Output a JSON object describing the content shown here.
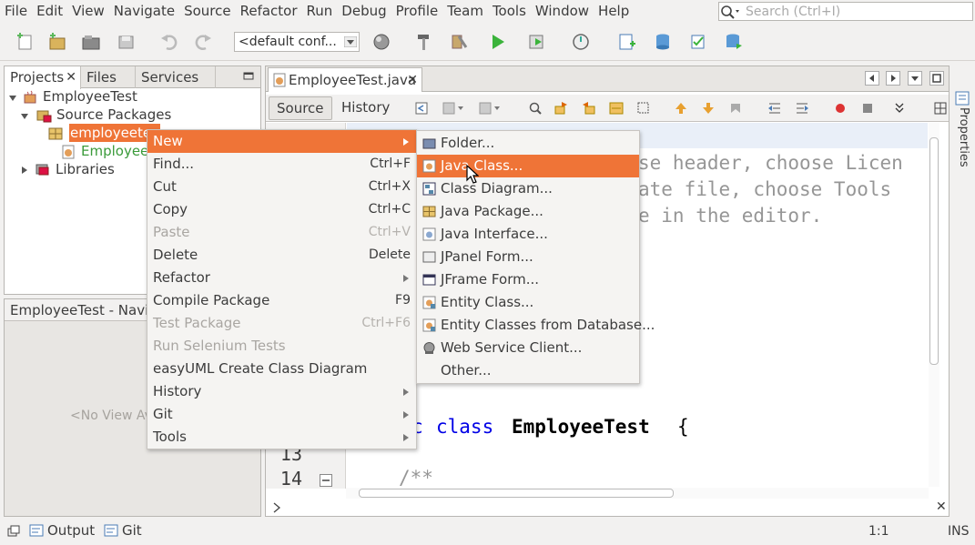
{
  "menubar": {
    "items": [
      "File",
      "Edit",
      "View",
      "Navigate",
      "Source",
      "Refactor",
      "Run",
      "Debug",
      "Profile",
      "Team",
      "Tools",
      "Window",
      "Help"
    ]
  },
  "search": {
    "placeholder": "Search (Ctrl+I)"
  },
  "toolbar": {
    "config_value": "<default conf..."
  },
  "projects_panel": {
    "tabs": [
      "Projects",
      "Files",
      "Services"
    ],
    "tree": {
      "project": "EmployeeTest",
      "source_packages": "Source Packages",
      "package": "employeete",
      "file": "EmployeeT",
      "libraries": "Libraries"
    }
  },
  "navigator": {
    "title": "EmployeeTest - Navig",
    "empty": "<No View Av"
  },
  "editor": {
    "file_tab": "EmployeeTest.java",
    "source_tab": "Source",
    "history_tab": "History",
    "lines": {
      "l13": "13",
      "l14": "14"
    },
    "code": {
      "c1": "se header, choose Licen",
      "c2": "ate file, choose Tools",
      "c3": "e in the editor.",
      "kw_c": "c",
      "kw_class": "class",
      "classname": "EmployeeTest",
      "brace": "{",
      "doc": "/**"
    },
    "side_panel": "Properties"
  },
  "context_menu": {
    "items": [
      {
        "label": "New",
        "shortcut": "",
        "submenu": true,
        "disabled": false
      },
      {
        "label": "Find...",
        "shortcut": "Ctrl+F",
        "submenu": false,
        "disabled": false
      },
      {
        "label": "Cut",
        "shortcut": "Ctrl+X",
        "submenu": false,
        "disabled": false
      },
      {
        "label": "Copy",
        "shortcut": "Ctrl+C",
        "submenu": false,
        "disabled": false
      },
      {
        "label": "Paste",
        "shortcut": "Ctrl+V",
        "submenu": false,
        "disabled": true
      },
      {
        "label": "Delete",
        "shortcut": "Delete",
        "submenu": false,
        "disabled": false
      },
      {
        "label": "Refactor",
        "shortcut": "",
        "submenu": true,
        "disabled": false
      },
      {
        "label": "Compile Package",
        "shortcut": "F9",
        "submenu": false,
        "disabled": false
      },
      {
        "label": "Test Package",
        "shortcut": "Ctrl+F6",
        "submenu": false,
        "disabled": true
      },
      {
        "label": "Run Selenium Tests",
        "shortcut": "",
        "submenu": false,
        "disabled": true
      },
      {
        "label": "easyUML Create Class Diagram",
        "shortcut": "",
        "submenu": false,
        "disabled": false
      },
      {
        "label": "History",
        "shortcut": "",
        "submenu": true,
        "disabled": false
      },
      {
        "label": "Git",
        "shortcut": "",
        "submenu": true,
        "disabled": false
      },
      {
        "label": "Tools",
        "shortcut": "",
        "submenu": true,
        "disabled": false
      }
    ]
  },
  "new_submenu": {
    "items": [
      {
        "label": "Folder...",
        "icon": "folder-icon"
      },
      {
        "label": "Java Class...",
        "icon": "java-class-icon"
      },
      {
        "label": "Class Diagram...",
        "icon": "class-diagram-icon"
      },
      {
        "label": "Java Package...",
        "icon": "package-icon"
      },
      {
        "label": "Java Interface...",
        "icon": "java-interface-icon"
      },
      {
        "label": "JPanel Form...",
        "icon": "jpanel-icon"
      },
      {
        "label": "JFrame Form...",
        "icon": "jframe-icon"
      },
      {
        "label": "Entity Class...",
        "icon": "entity-class-icon"
      },
      {
        "label": "Entity Classes from Database...",
        "icon": "entity-db-icon"
      },
      {
        "label": "Web Service Client...",
        "icon": "web-service-icon"
      },
      {
        "label": "Other...",
        "icon": ""
      }
    ]
  },
  "statusbar": {
    "output": "Output",
    "git": "Git",
    "position": "1:1",
    "mode": "INS"
  },
  "colors": {
    "highlight": "#ef7437",
    "keyword": "#0000e6",
    "comment": "#969696"
  }
}
